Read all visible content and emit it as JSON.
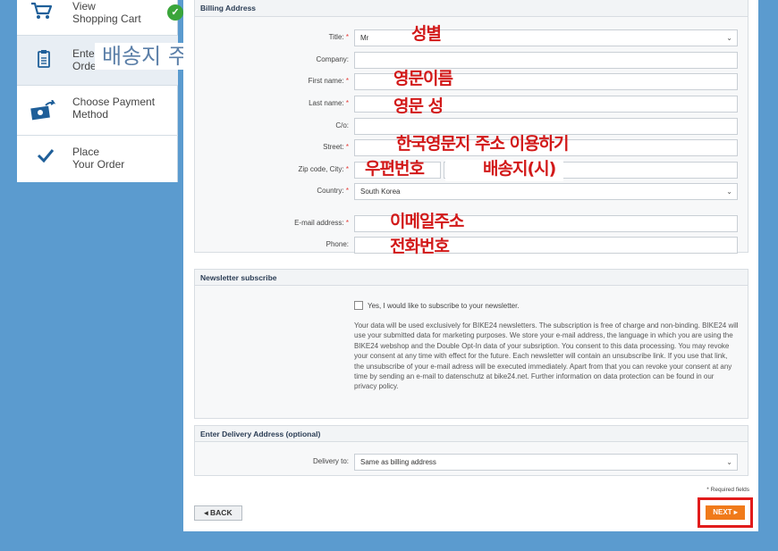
{
  "sidebar": {
    "steps": [
      {
        "label": "View\nShopping Cart",
        "icon": "cart-icon",
        "done": true
      },
      {
        "label": "Enter\nOrder",
        "icon": "clipboard-icon"
      },
      {
        "label": "Choose Payment\nMethod",
        "icon": "payment-icon"
      },
      {
        "label": "Place\nYour Order",
        "icon": "checkmark-icon"
      }
    ],
    "overlay_label": "배송지 주소입력하기",
    "check_icon": "✓"
  },
  "billing": {
    "heading": "Billing Address",
    "fields": {
      "title": {
        "label": "Title:",
        "value": "Mr"
      },
      "company": {
        "label": "Company:"
      },
      "first_name": {
        "label": "First name:"
      },
      "last_name": {
        "label": "Last name:"
      },
      "co": {
        "label": "C/o:"
      },
      "street": {
        "label": "Street:"
      },
      "zip_city": {
        "label": "Zip code, City:"
      },
      "country": {
        "label": "Country:",
        "value": "South Korea"
      },
      "email": {
        "label": "E-mail address:"
      },
      "phone": {
        "label": "Phone:"
      }
    },
    "required_mark": "*",
    "annotations": {
      "title": "성별",
      "first_name": "영문이름",
      "last_name": "영문 성",
      "street": "한국영문지 주소 이용하기",
      "zip": "우편번호",
      "city": "배송지(시)",
      "email": "이메일주소",
      "phone": "전화번호"
    }
  },
  "newsletter": {
    "heading": "Newsletter subscribe",
    "checkbox_label": "Yes, I would like to subscribe to your newsletter.",
    "description": "Your data will be used exclusively for BIKE24 newsletters. The subscription is free of charge and non-binding. BIKE24 will use your submitted data for marketing purposes. We store your e-mail address, the language in which you are using the BIKE24 webshop and the Double Opt-In data of your subsription. You consent to this data processing. You may revoke your consent at any time with effect for the future. Each newsletter will contain an unsubscribe link. If you use that link, the unsubscribe of your e-mail adress will be executed immediately. Apart from that you can revoke your consent at any time by sending an e-mail to datenschutz at bike24.net. Further information on data protection can be found in our privacy policy."
  },
  "delivery": {
    "heading": "Enter Delivery Address (optional)",
    "label": "Delivery to:",
    "value": "Same as billing address"
  },
  "footer": {
    "required_note": "* Required fields",
    "back_label": "◂ BACK",
    "next_label": "NEXT ▸"
  },
  "colors": {
    "background": "#5b9bcf",
    "accent_orange": "#f07a1a",
    "annotation_red": "#d21919",
    "check_green": "#3aa53a"
  }
}
